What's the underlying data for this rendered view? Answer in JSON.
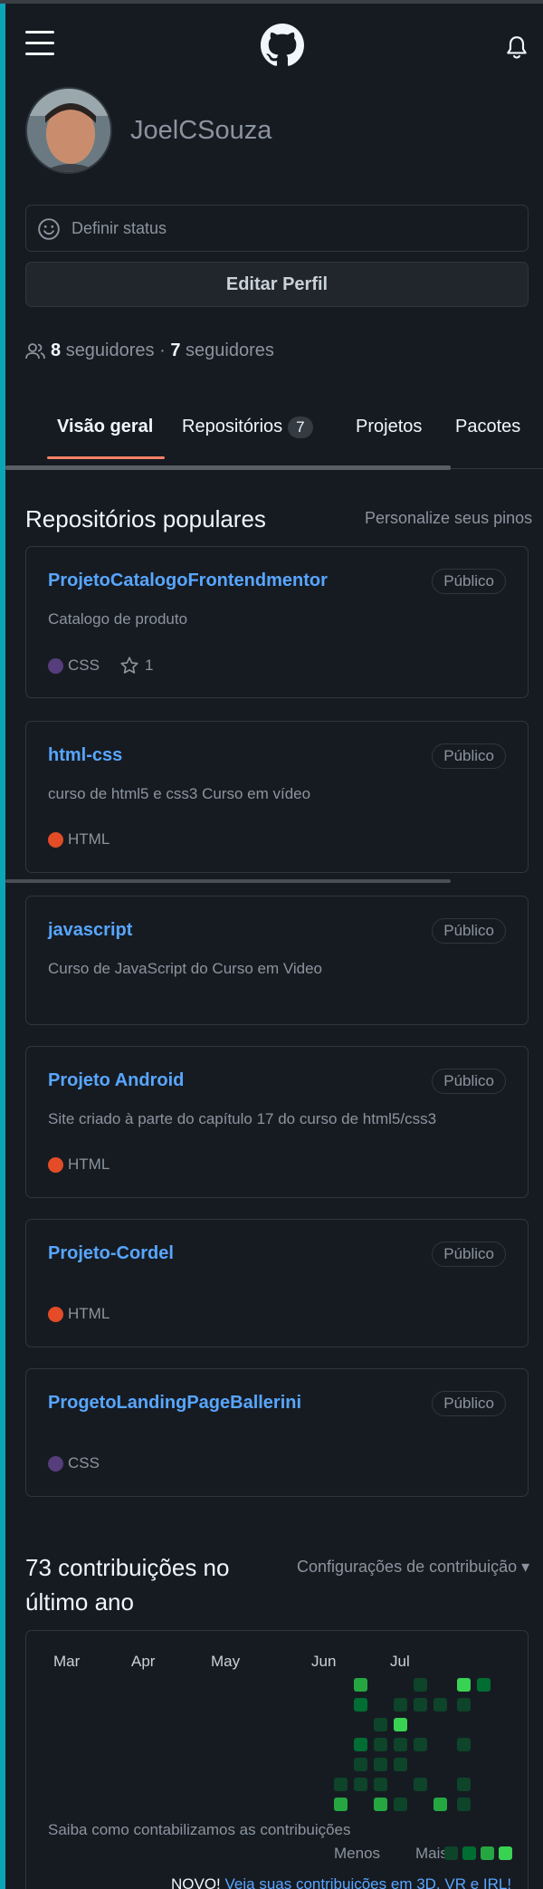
{
  "colors": {
    "background": "#161b22",
    "link": "#58a6ff",
    "tab_underline": "#f78166",
    "css_lang": "#563d7c",
    "html_lang": "#e34c26",
    "contrib_levels": [
      "#0e4429",
      "#006d32",
      "#26a641",
      "#39d353"
    ]
  },
  "header": {
    "menu_icon": "hamburger-icon",
    "logo_icon": "github-logo-icon",
    "bell_icon": "bell-icon"
  },
  "profile": {
    "username": "JoelCSouza",
    "status_label": "Definir status",
    "edit_label": "Editar Perfil",
    "followers_count": "8",
    "followers_label": "seguidores",
    "separator": "·",
    "following_count": "7",
    "following_label": "seguidores"
  },
  "tabs": [
    {
      "label": "Visão geral"
    },
    {
      "label": "Repositórios",
      "count": "7"
    },
    {
      "label": "Projetos"
    },
    {
      "label": "Pacotes"
    }
  ],
  "popular": {
    "title": "Repositórios populares",
    "customize": "Personalize seus pinos",
    "repos": [
      {
        "name": "ProjetoCatalogoFrontendmentor",
        "badge": "Público",
        "description": "Catalogo de produto",
        "language": "CSS",
        "stars": "1"
      },
      {
        "name": "html-css",
        "badge": "Público",
        "description": "curso de html5 e css3 Curso em vídeo",
        "language": "HTML"
      },
      {
        "name": "javascript",
        "badge": "Público",
        "description": "Curso de JavaScript do Curso em Video"
      },
      {
        "name": "Projeto Android",
        "badge": "Público",
        "description": "Site criado à parte do capítulo 17 do curso de html5/css3",
        "language": "HTML"
      },
      {
        "name": "Projeto-Cordel",
        "badge": "Público",
        "language": "HTML"
      },
      {
        "name": "ProgetoLandingPageBallerini",
        "badge": "Público",
        "language": "CSS"
      }
    ]
  },
  "contributions": {
    "title": "73 contribuições no último ano",
    "settings_label": "Configurações de contribuição ▾",
    "months": [
      "Mar",
      "Apr",
      "May",
      "Jun",
      "Jul"
    ],
    "learn_link": "Saiba como contabilizamos as contribuições",
    "legend_less": "Menos",
    "legend_more": "Mais",
    "news_prefix": "NOVO!",
    "news_link": "Veja suas contribuições em 3D, VR e IRL!"
  }
}
